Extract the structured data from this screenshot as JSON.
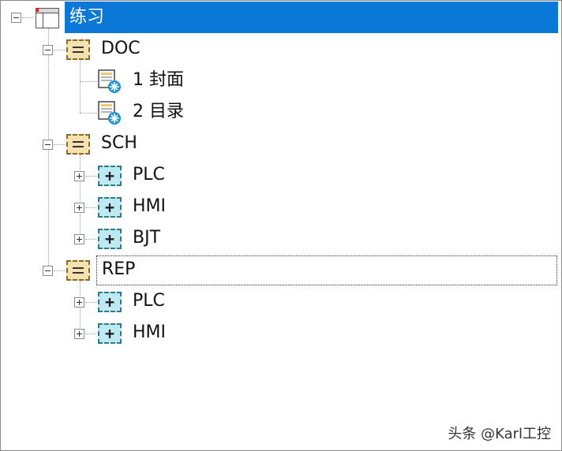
{
  "tree": {
    "root": {
      "label": "练习",
      "icon": "window-icon",
      "selected": true
    },
    "groups": [
      {
        "label": "DOC",
        "icon": "folder-icon",
        "expanded": true,
        "children": [
          {
            "label": "1 封面",
            "icon": "document-icon"
          },
          {
            "label": "2 目录",
            "icon": "document-icon"
          }
        ]
      },
      {
        "label": "SCH",
        "icon": "folder-icon",
        "expanded": true,
        "children": [
          {
            "label": "PLC",
            "icon": "plus-box-icon"
          },
          {
            "label": "HMI",
            "icon": "plus-box-icon"
          },
          {
            "label": "BJT",
            "icon": "plus-box-icon"
          }
        ]
      },
      {
        "label": "REP",
        "icon": "folder-icon",
        "expanded": true,
        "focused": true,
        "children": [
          {
            "label": "PLC",
            "icon": "plus-box-icon"
          },
          {
            "label": "HMI",
            "icon": "plus-box-icon"
          }
        ]
      }
    ]
  },
  "watermark": "头条 @Karl工控",
  "colors": {
    "selection": "#0a78d7",
    "folder_fill": "#f6e2b0",
    "plus_fill": "#bfe9f0"
  }
}
